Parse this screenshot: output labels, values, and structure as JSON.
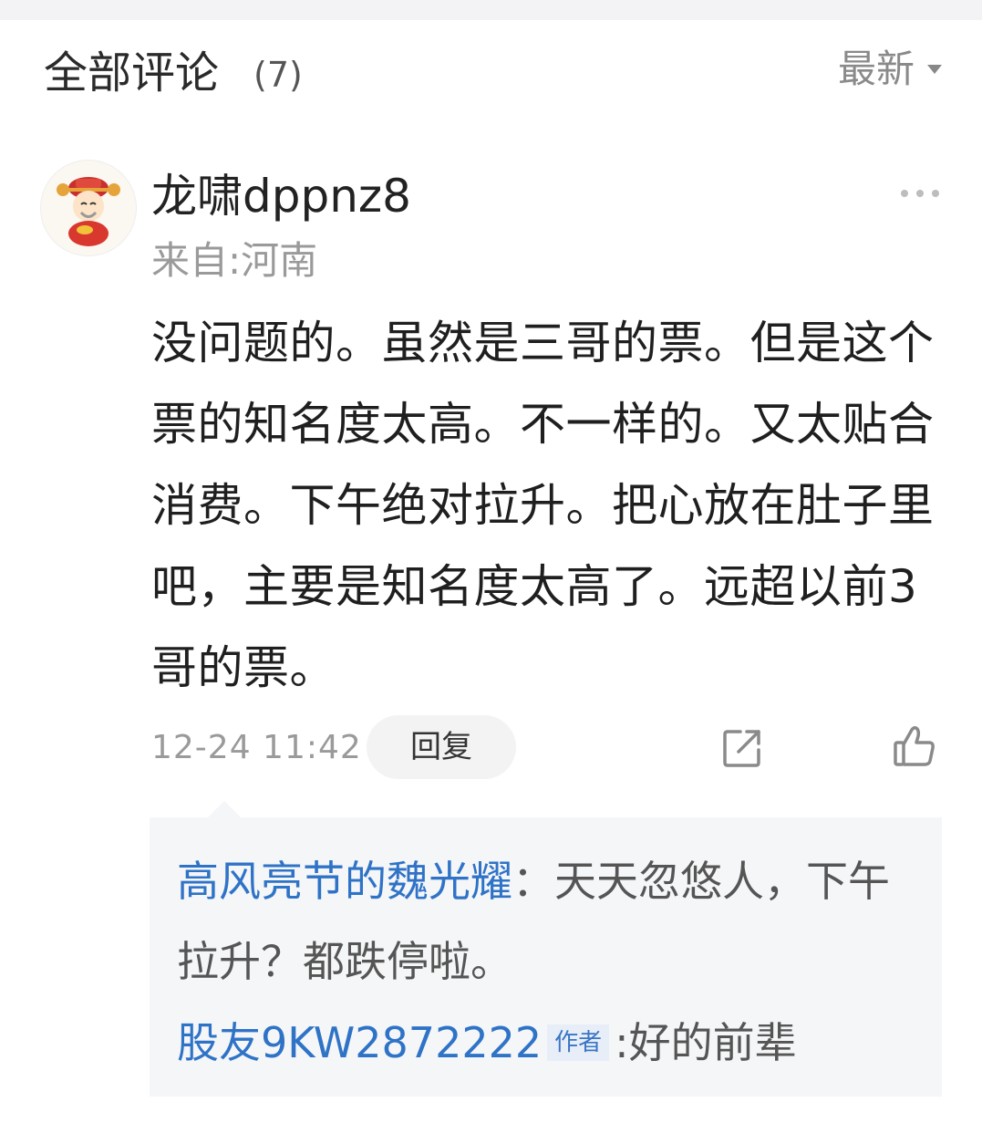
{
  "header": {
    "title": "全部评论",
    "count": "(7)",
    "sort_label": "最新"
  },
  "comment": {
    "username": "龙啸dppnz8",
    "location": "来自:河南",
    "content": "没问题的。虽然是三哥的票。但是这个票的知名度太高。不一样的。又太贴合消费。下午绝对拉升。把心放在肚子里吧，主要是知名度太高了。远超以前3哥的票。",
    "time": "12-24 11:42",
    "reply_label": "回复"
  },
  "replies": [
    {
      "user": "高风亮节的魏光耀",
      "separator": "：",
      "text": "天天忽悠人，下午拉升？都跌停啦。"
    },
    {
      "user": "股友9KW2872222",
      "badge": "作者",
      "separator": ":",
      "text": "好的前辈"
    }
  ],
  "icons": {
    "more": "more-dots-icon",
    "sort": "caret-down-icon",
    "share": "share-icon",
    "like": "thumbs-up-icon",
    "avatar": "caishen-avatar"
  },
  "colors": {
    "link_blue": "#2f73c7",
    "muted_gray": "#9a9a9a",
    "reply_bg": "#f5f6f8"
  }
}
